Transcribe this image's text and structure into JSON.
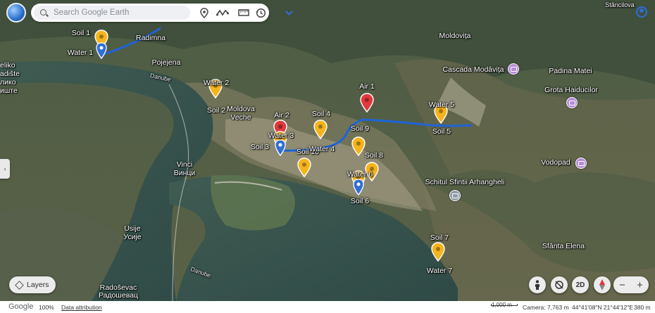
{
  "search": {
    "placeholder": "Search Google Earth"
  },
  "toolbar": {
    "icons": [
      "pin-icon",
      "path-icon",
      "ruler-icon",
      "history-icon",
      "chevron-down-icon"
    ]
  },
  "map": {
    "places": {
      "radimna": "Radimna",
      "pojejena": "Pojejena",
      "moldovita": "Moldovița",
      "cascada": "Cascada Modâvița",
      "padina": "Padina Matei",
      "grota": "Grota Haiducilor",
      "moldova_veche": "Moldova Veche",
      "vinci_lat": "Vinci",
      "vinci_cyr": "Винци",
      "schitul": "Schitul Sfintii Arhangheli",
      "vodopad": "Vodopad",
      "usije_lat": "Usije",
      "usije_cyr": "Усије",
      "sfanta_elena": "Sfânta Elena",
      "radosevac_lat": "Radoševac",
      "radosevac_cyr": "Радошевац",
      "stancilova": "Stâncilova",
      "veliko_lat": "eliko",
      "gradiste_lat": "adište",
      "veliko_cyr": "лико",
      "gradiste_cyr": "иште",
      "danube1": "Danube",
      "danube2": "Danube"
    },
    "markers": {
      "soil1": "Soil 1",
      "water1": "Water 1",
      "water2": "Water 2",
      "soil2": "Soil 2",
      "air1": "Air 1",
      "air2": "Air 2",
      "soil4": "Soil 4",
      "soil9": "Soil 9",
      "water3": "Water 3",
      "soil3": "Soil 3",
      "soil10": "Soil 10",
      "water4": "Water 4",
      "soil8": "Soil 8",
      "water6": "Water 6",
      "soil6": "Soil 6",
      "water5": "Water 5",
      "soil5": "Soil 5",
      "soil7": "Soil 7",
      "water7": "Water 7"
    },
    "colors": {
      "soil": "#f5b41c",
      "air": "#e2383d",
      "water_pin": "#2f6fd6",
      "track": "#1f64d6"
    }
  },
  "controls": {
    "layers_label": "Layers",
    "view_2d": "2D",
    "zoom_out": "−",
    "zoom_in": "+"
  },
  "status": {
    "google": "Google",
    "zoom": "100%",
    "attribution": "Data attribution",
    "scale": "1,000 m",
    "camera": "Camera: 7,763 m",
    "coords": "44°41'08\"N 21°44'12\"E",
    "elevation": "380 m"
  }
}
